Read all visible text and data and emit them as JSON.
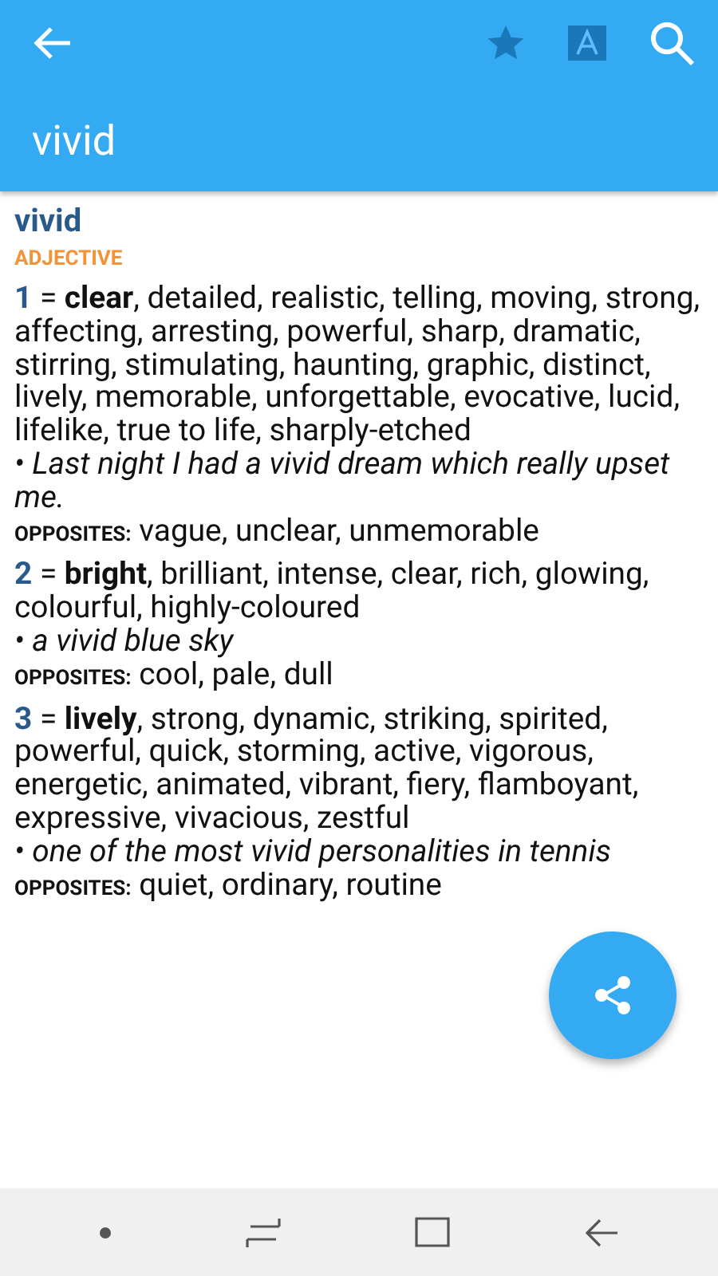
{
  "toolbar": {
    "title": "vivid"
  },
  "entry": {
    "headword": "vivid",
    "part_of_speech": "ADJECTIVE",
    "senses": [
      {
        "number": "1",
        "definition": "= **clear**, detailed, realistic, telling, moving, strong, affecting, arresting, powerful, sharp, dramatic, stirring, stimulating, haunting, graphic, distinct, lively, memorable, unforgettable, evocative, lucid, lifelike, true to life, sharply-etched",
        "example": "• Last night I had a vivid dream which really upset me.",
        "opposites_label": "OPPOSITES:",
        "opposites": "vague, unclear, unmemorable"
      },
      {
        "number": "2",
        "definition": "= **bright**, brilliant, intense, clear, rich, glowing, colourful, highly-coloured",
        "example": "• a vivid blue sky",
        "opposites_label": "OPPOSITES:",
        "opposites": "cool, pale, dull"
      },
      {
        "number": "3",
        "definition": "= **lively**, strong, dynamic, striking, spirited, powerful, quick, storming, active, vigorous, energetic, animated, vibrant, fiery, flamboyant, expressive, vivacious, zestful",
        "example": "• one of the most vivid personalities in tennis",
        "opposites_label": "OPPOSITES:",
        "opposites": "quiet, ordinary, routine"
      }
    ]
  }
}
